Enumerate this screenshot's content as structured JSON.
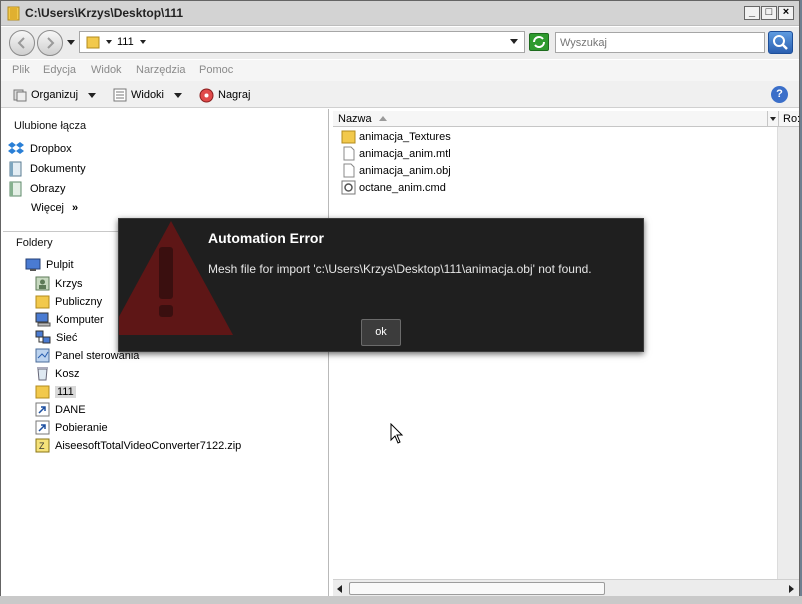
{
  "window": {
    "title": "C:\\Users\\Krzys\\Desktop\\111",
    "min_glyph": "_",
    "max_glyph": "□",
    "close_glyph": "×"
  },
  "address": {
    "path_segment": "111",
    "search_placeholder": "Wyszukaj"
  },
  "menu": [
    "Plik",
    "Edycja",
    "Widok",
    "Narzędzia",
    "Pomoc"
  ],
  "toolbar": {
    "organize": "Organizuj",
    "views": "Widoki",
    "burn": "Nagraj",
    "help_glyph": "?"
  },
  "favorites": {
    "heading": "Ulubione łącza",
    "items": [
      "Dropbox",
      "Dokumenty",
      "Obrazy"
    ],
    "more": "Więcej",
    "more_glyph": "»"
  },
  "folders": {
    "heading": "Foldery",
    "items": [
      {
        "label": "Pulpit",
        "icon": "desktop-icon"
      },
      {
        "label": "Krzys",
        "icon": "user-folder-icon"
      },
      {
        "label": "Publiczny",
        "icon": "folder-icon"
      },
      {
        "label": "Komputer",
        "icon": "computer-icon"
      },
      {
        "label": "Sieć",
        "icon": "network-icon"
      },
      {
        "label": "Panel sterowania",
        "icon": "control-panel-icon"
      },
      {
        "label": "Kosz",
        "icon": "recycle-bin-icon"
      },
      {
        "label": "111",
        "icon": "folder-icon"
      },
      {
        "label": "DANE",
        "icon": "shortcut-icon"
      },
      {
        "label": "Pobieranie",
        "icon": "shortcut-icon"
      },
      {
        "label": "AiseesoftTotalVideoConverter7122.zip",
        "icon": "zip-icon"
      }
    ]
  },
  "filelist": {
    "col_name": "Nazwa",
    "col_ro": "Ro:",
    "items": [
      {
        "label": "animacja_Textures",
        "icon": "folder-icon"
      },
      {
        "label": "animacja_anim.mtl",
        "icon": "file-icon"
      },
      {
        "label": "animacja_anim.obj",
        "icon": "file-icon"
      },
      {
        "label": "octane_anim.cmd",
        "icon": "cmd-file-icon"
      }
    ]
  },
  "dialog": {
    "title": "Automation Error",
    "message": "Mesh file for import 'c:\\Users\\Krzys\\Desktop\\111\\animacja.obj' not found.",
    "ok": "ok"
  },
  "colors": {
    "dialog_bg": "#1f1f1f",
    "warning_red": "#7a1a1a",
    "folder_yellow": "#f2c94c"
  }
}
